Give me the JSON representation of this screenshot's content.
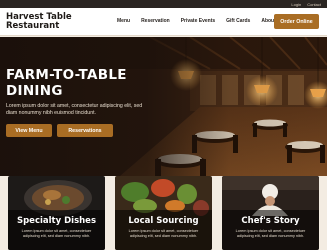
{
  "topbar": {
    "links": [
      "Login",
      "Contact"
    ]
  },
  "nav": {
    "logo": "Harvest Table Restaurant",
    "menu": [
      "Menu",
      "Reservation",
      "Private Events",
      "Gift Cards",
      "About"
    ],
    "order_button": "Order Online"
  },
  "hero": {
    "title_line1": "FARM-TO-TABLE",
    "title_line2": "DINING",
    "text": "Lorem ipsum dolor sit amet, consectetur adipiscing elit, sed diam nonummy nibh euismod tincidunt.",
    "buttons": [
      "View Menu",
      "Reservations"
    ]
  },
  "cards": [
    {
      "title": "Specialty Dishes",
      "text": "Lorem ipsum dolor sit amet, consectetuer adipiscing elit, sed diam nonummy nibh."
    },
    {
      "title": "Local Sourcing",
      "text": "Lorem ipsum dolor sit amet, consectetuer adipiscing elit, sed diam nonummy nibh."
    },
    {
      "title": "Chef's Story",
      "text": "Lorem ipsum dolor sit amet, consectetuer adipiscing elit, sed diam nonummy nibh."
    }
  ],
  "colors": {
    "accent": "#a96d24",
    "dark": "#2a2522",
    "cream": "#f3ece2"
  }
}
